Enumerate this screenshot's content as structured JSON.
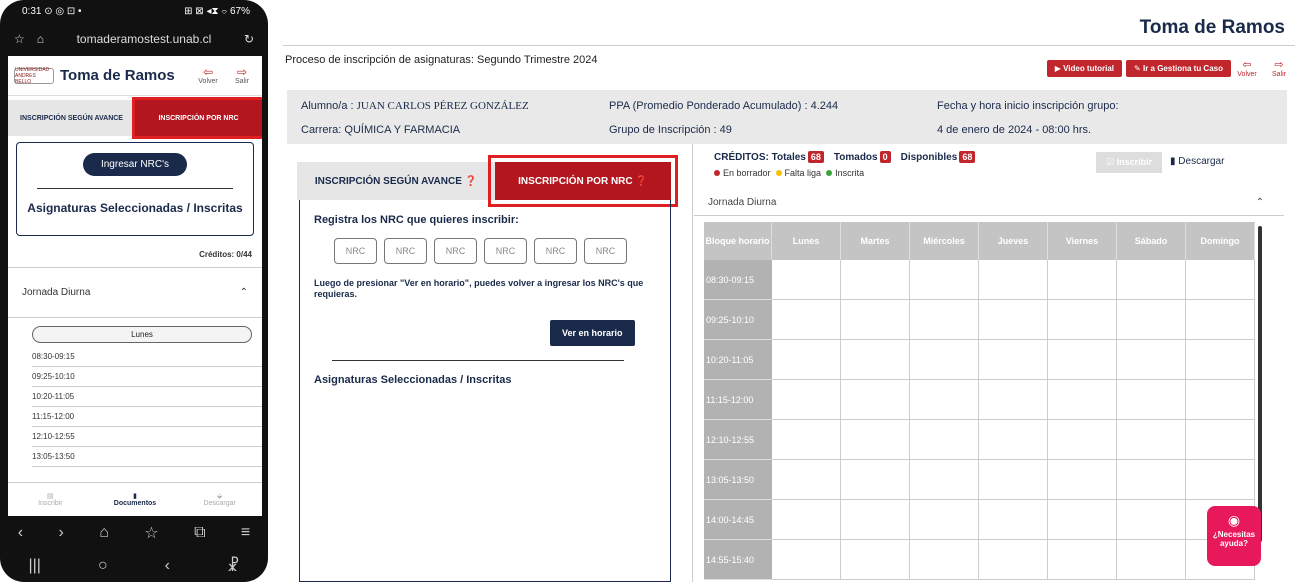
{
  "phone": {
    "status_left": "0:31 ⊙ ◎ ⊡ •",
    "status_right": "⊞ ⊠ ◂⧗ ⌔ 67%",
    "url": "tomaderamostest.unab.cl",
    "app_title": "Toma de Ramos",
    "logo_text": "UNIVERSIDAD ANDRES BELLO",
    "volver": "Volver",
    "salir": "Salir",
    "tab_avance": "INSCRIPCIÓN SEGÚN AVANCE",
    "tab_nrc": "INSCRIPCIÓN POR NRC",
    "ingresar_btn": "Ingresar NRC's",
    "asignaturas": "Asignaturas Seleccionadas / Inscritas",
    "creditos": "Créditos: 0/44",
    "jornada": "Jornada Diurna",
    "dia": "Lunes",
    "slots": [
      "08:30-09:15",
      "09:25-10:10",
      "10:20-11:05",
      "11:15-12:00",
      "12:10-12:55",
      "13:05-13:50"
    ],
    "bottom": {
      "inscribir": "Inscribir",
      "documentos": "Documentos",
      "descargar": "Descargar"
    }
  },
  "desk": {
    "top_title": "Toma de Ramos",
    "proceso": "Proceso de inscripción de asignaturas: Segundo Trimestre 2024",
    "video_btn": "Video tutorial",
    "gestiona_btn": "Ir a Gestiona tu Caso",
    "volver": "Volver",
    "salir": "Salir",
    "alumno_label": "Alumno/a :",
    "alumno": "JUAN CARLOS PÉREZ GONZÁLEZ",
    "carrera": "Carrera: QUÍMICA Y FARMACIA",
    "ppa": "PPA (Promedio Ponderado Acumulado) : 4.244",
    "grupo": "Grupo de Inscripción : 49",
    "fecha_label": "Fecha y hora inicio inscripción grupo:",
    "fecha": "4 de enero de 2024 - 08:00 hrs.",
    "tab_avance": "INSCRIPCIÓN SEGÚN AVANCE",
    "tab_nrc": "INSCRIPCIÓN POR NRC",
    "registra": "Registra los NRC que quieres inscribir:",
    "nrc_placeholder": "NRC",
    "nota": "Luego de presionar \"Ver en horario\", puedes volver a ingresar los NRC's que requieras.",
    "ver_btn": "Ver en horario",
    "asignaturas": "Asignaturas Seleccionadas / Inscritas",
    "creditos_label": "CRÉDITOS: Totales",
    "totales": "68",
    "tomados_label": "Tomados",
    "tomados": "0",
    "disponibles_label": "Disponibles",
    "disponibles": "68",
    "legend_borrador": "En borrador",
    "legend_falta": "Falta liga",
    "legend_inscrita": "Inscrita",
    "inscribir_btn": "Inscribir",
    "descargar": "Descargar",
    "jornada": "Jornada Diurna",
    "bloque": "Bloque horario",
    "days": [
      "Lunes",
      "Martes",
      "Miércoles",
      "Jueves",
      "Viernes",
      "Sábado",
      "Domingo"
    ],
    "slots": [
      "08:30-09:15",
      "09:25-10:10",
      "10:20-11:05",
      "11:15-12:00",
      "12:10-12:55",
      "13:05-13:50",
      "14:00-14:45",
      "14:55-15:40"
    ],
    "help": "¿Necesitas ayuda?"
  },
  "colors": {
    "brand_red": "#c0262c",
    "navy": "#1a2a4a",
    "help_pink": "#e8195a"
  }
}
